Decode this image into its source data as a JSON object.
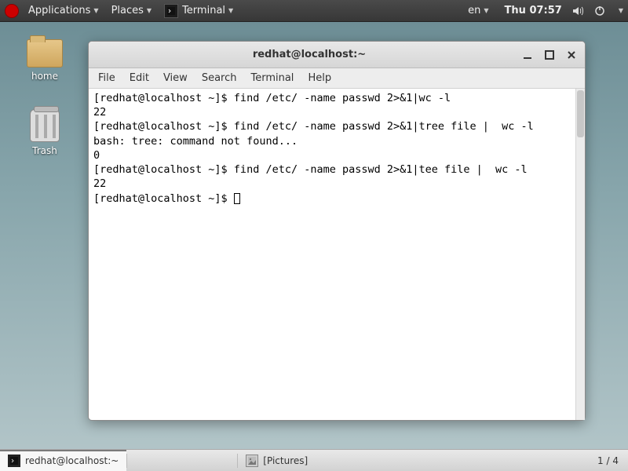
{
  "top_bar": {
    "applications": "Applications",
    "places": "Places",
    "app_name": "Terminal",
    "lang": "en",
    "clock": "Thu 07:57"
  },
  "desktop": {
    "home_label": "home",
    "trash_label": "Trash"
  },
  "window": {
    "title": "redhat@localhost:~",
    "menu": {
      "file": "File",
      "edit": "Edit",
      "view": "View",
      "search": "Search",
      "terminal": "Terminal",
      "help": "Help"
    }
  },
  "terminal": {
    "lines": [
      "[redhat@localhost ~]$ find /etc/ -name passwd 2>&1|wc -l",
      "22",
      "[redhat@localhost ~]$ find /etc/ -name passwd 2>&1|tree file |  wc -l",
      "bash: tree: command not found...",
      "0",
      "[redhat@localhost ~]$ find /etc/ -name passwd 2>&1|tee file |  wc -l",
      "22"
    ],
    "prompt": "[redhat@localhost ~]$ "
  },
  "taskbar": {
    "task1": "redhat@localhost:~",
    "task2": "[Pictures]",
    "workspace": "1 / 4"
  }
}
